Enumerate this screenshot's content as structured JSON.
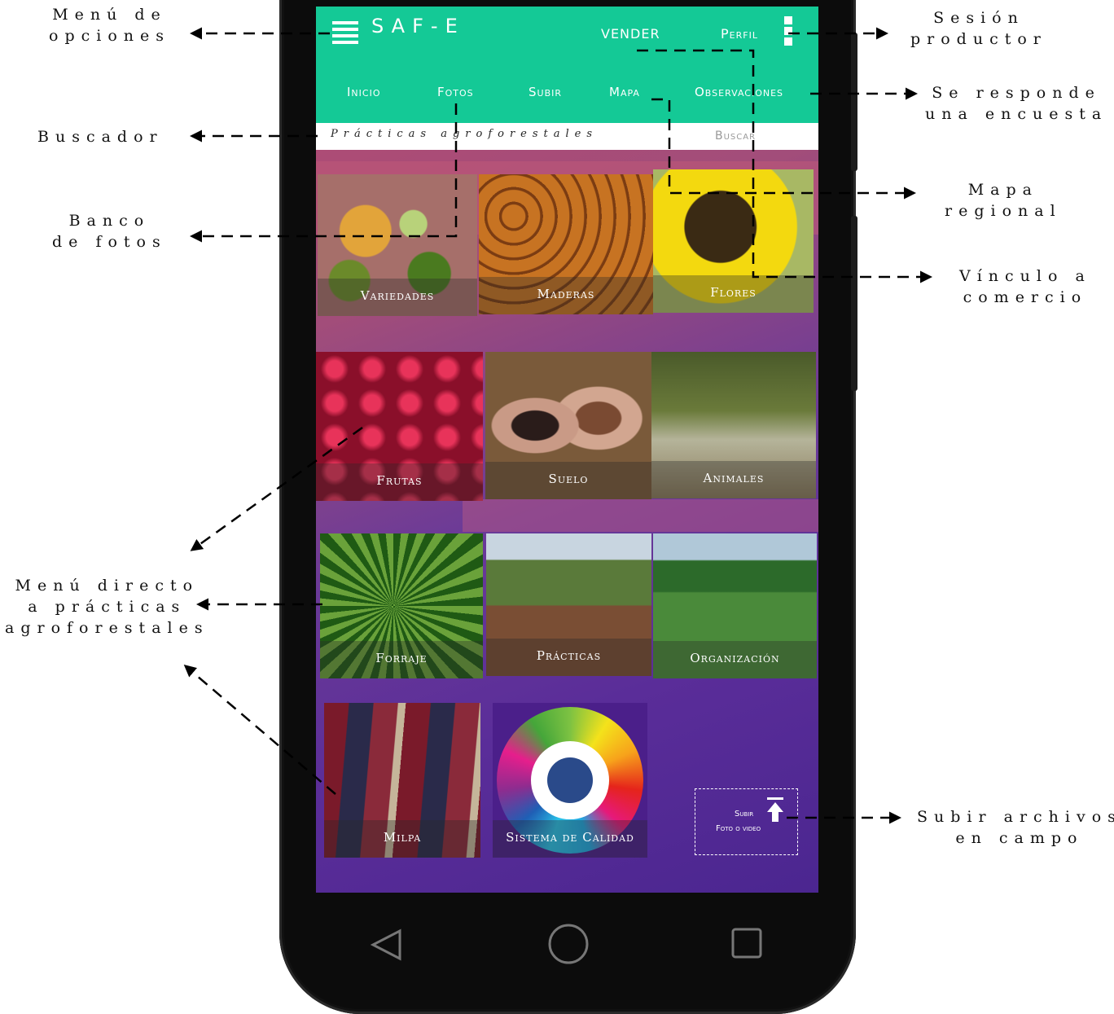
{
  "annotations": {
    "menu_options": [
      "Menú de",
      "opciones"
    ],
    "search_engine": [
      "Buscador"
    ],
    "photo_bank": [
      "Banco",
      "de fotos"
    ],
    "direct_menu": [
      "Menú directo",
      "a prácticas",
      "agroforestales"
    ],
    "producer_session": [
      "Sesión",
      "productor"
    ],
    "survey": [
      "Se responde",
      "una encuesta"
    ],
    "regional_map": [
      "Mapa",
      "regional"
    ],
    "commerce_link": [
      "Vínculo a",
      "comercio"
    ],
    "upload_field": [
      "Subir archivos",
      "en campo"
    ]
  },
  "app": {
    "brand": "SAF-E",
    "sell": "VENDER",
    "profile": "Perfil",
    "tabs": [
      "Inicio",
      "Fotos",
      "Subir",
      "Mapa",
      "Observaciones"
    ],
    "search_placeholder": "Prácticas agroforestales",
    "search_button": "Buscar"
  },
  "tiles": [
    "Variedades",
    "Maderas",
    "Flores",
    "Frutas",
    "Suelo",
    "Animales",
    "Forraje",
    "Prácticas",
    "Organización",
    "Milpa",
    "Sistema de Calidad"
  ],
  "upload": {
    "line1": "Subir",
    "line2": "Foto o video"
  },
  "colors": {
    "appbar": "#14c996",
    "accent": "#ffffff"
  }
}
